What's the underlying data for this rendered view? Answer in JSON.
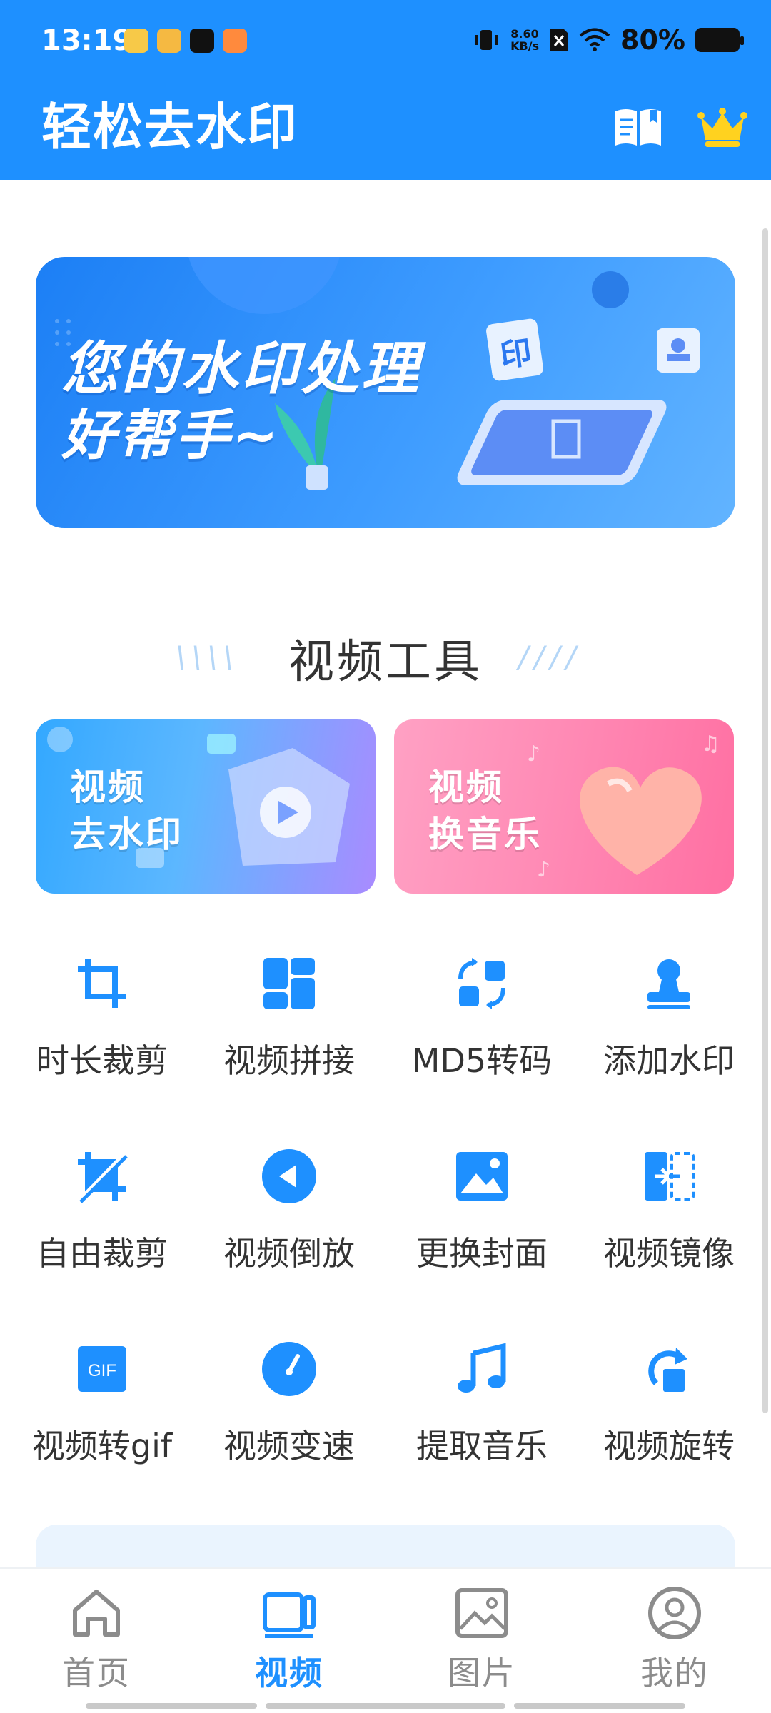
{
  "status_bar": {
    "time": "13:19",
    "net_speed_value": "8.60",
    "net_speed_unit": "KB/s",
    "battery": "80%"
  },
  "header": {
    "title": "轻松去水印",
    "book_icon": "book-open-icon",
    "vip_icon": "crown-icon"
  },
  "banner": {
    "line1": "您的水印处理",
    "line2": "好帮手~",
    "badge_char": "印"
  },
  "section": {
    "title": "视频工具",
    "left_deco": "\\\\\\\\",
    "right_deco": "////"
  },
  "cards": [
    {
      "line1": "视频",
      "line2": "去水印"
    },
    {
      "line1": "视频",
      "line2": "换音乐"
    }
  ],
  "tools": [
    {
      "label": "时长裁剪",
      "icon": "crop-icon"
    },
    {
      "label": "视频拼接",
      "icon": "layout-grid-icon"
    },
    {
      "label": "MD5转码",
      "icon": "convert-icon"
    },
    {
      "label": "添加水印",
      "icon": "stamp-icon"
    },
    {
      "label": "自由裁剪",
      "icon": "free-crop-icon"
    },
    {
      "label": "视频倒放",
      "icon": "rewind-icon"
    },
    {
      "label": "更换封面",
      "icon": "image-icon"
    },
    {
      "label": "视频镜像",
      "icon": "mirror-icon"
    },
    {
      "label": "视频转gif",
      "icon": "gif-icon",
      "icon_text": "GIF"
    },
    {
      "label": "视频变速",
      "icon": "speedometer-icon"
    },
    {
      "label": "提取音乐",
      "icon": "music-note-icon"
    },
    {
      "label": "视频旋转",
      "icon": "rotate-icon"
    }
  ],
  "bottom_nav": [
    {
      "label": "首页",
      "icon": "home-icon",
      "active": false
    },
    {
      "label": "视频",
      "icon": "video-icon",
      "active": true
    },
    {
      "label": "图片",
      "icon": "picture-icon",
      "active": false
    },
    {
      "label": "我的",
      "icon": "user-icon",
      "active": false
    }
  ],
  "colors": {
    "primary": "#1e90ff",
    "nav_inactive": "#8c8c8c",
    "text": "#333333"
  }
}
